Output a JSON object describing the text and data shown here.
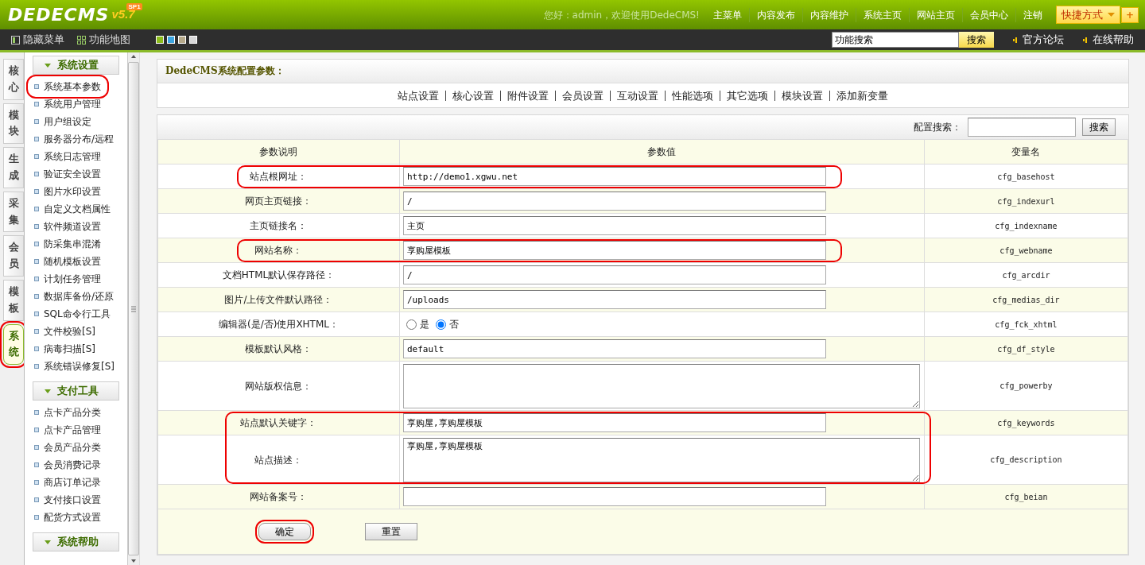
{
  "header": {
    "logo": "DEDECMS",
    "version": "v5.7",
    "edition": "SP1",
    "greeting": "您好：admin，欢迎使用DedeCMS!",
    "nav": [
      "主菜单",
      "内容发布",
      "内容维护",
      "系统主页",
      "网站主页",
      "会员中心",
      "注销"
    ],
    "quick_button": "快捷方式",
    "quick_add": "+"
  },
  "toolbar": {
    "hide_menu": "隐藏菜单",
    "site_map": "功能地图",
    "themes": [
      {
        "color": "#8cbc1c"
      },
      {
        "color": "#3da5e0"
      },
      {
        "color": "#b5a98a"
      },
      {
        "color": "#d8d8d8"
      }
    ],
    "search": {
      "value": "功能搜索",
      "button": "搜索"
    },
    "links": [
      "官方论坛",
      "在线帮助"
    ]
  },
  "side_tabs": [
    {
      "label": "核心",
      "selected": false,
      "highlighted": false
    },
    {
      "label": "模块",
      "selected": false,
      "highlighted": false
    },
    {
      "label": "生成",
      "selected": false,
      "highlighted": false
    },
    {
      "label": "采集",
      "selected": false,
      "highlighted": false
    },
    {
      "label": "会员",
      "selected": false,
      "highlighted": false
    },
    {
      "label": "模板",
      "selected": false,
      "highlighted": false
    },
    {
      "label": "系统",
      "selected": true,
      "highlighted": true
    }
  ],
  "menu_groups": [
    {
      "title": "系统设置",
      "items": [
        {
          "label": "系统基本参数",
          "highlighted": true
        },
        {
          "label": "系统用户管理",
          "highlighted": false
        },
        {
          "label": "用户组设定",
          "highlighted": false
        },
        {
          "label": "服务器分布/远程",
          "highlighted": false
        },
        {
          "label": "系统日志管理",
          "highlighted": false
        },
        {
          "label": "验证安全设置",
          "highlighted": false
        },
        {
          "label": "图片水印设置",
          "highlighted": false
        },
        {
          "label": "自定义文档属性",
          "highlighted": false
        },
        {
          "label": "软件频道设置",
          "highlighted": false
        },
        {
          "label": "防采集串混淆",
          "highlighted": false
        },
        {
          "label": "随机模板设置",
          "highlighted": false
        },
        {
          "label": "计划任务管理",
          "highlighted": false
        },
        {
          "label": "数据库备份/还原",
          "highlighted": false
        },
        {
          "label": "SQL命令行工具",
          "highlighted": false
        },
        {
          "label": "文件校验[S]",
          "highlighted": false
        },
        {
          "label": "病毒扫描[S]",
          "highlighted": false
        },
        {
          "label": "系统错误修复[S]",
          "highlighted": false
        }
      ]
    },
    {
      "title": "支付工具",
      "items": [
        {
          "label": "点卡产品分类",
          "highlighted": false
        },
        {
          "label": "点卡产品管理",
          "highlighted": false
        },
        {
          "label": "会员产品分类",
          "highlighted": false
        },
        {
          "label": "会员消费记录",
          "highlighted": false
        },
        {
          "label": "商店订单记录",
          "highlighted": false
        },
        {
          "label": "支付接口设置",
          "highlighted": false
        },
        {
          "label": "配货方式设置",
          "highlighted": false
        }
      ]
    },
    {
      "title": "系统帮助"
    }
  ],
  "main": {
    "title": "DedeCMS系统配置参数：",
    "sections": [
      "站点设置",
      "核心设置",
      "附件设置",
      "会员设置",
      "互动设置",
      "性能选项",
      "其它选项",
      "模块设置",
      "添加新变量"
    ],
    "config_search": {
      "label": "配置搜索：",
      "button": "搜索"
    },
    "columns": [
      "参数说明",
      "参数值",
      "变量名"
    ],
    "rows": [
      {
        "label": "站点根网址：",
        "kind": "text",
        "value": "http://demo1.xgwu.net",
        "var": "cfg_basehost",
        "highlighted": true
      },
      {
        "label": "网页主页链接：",
        "kind": "text",
        "value": "/",
        "var": "cfg_indexurl",
        "highlighted": false
      },
      {
        "label": "主页链接名：",
        "kind": "text",
        "value": "主页",
        "var": "cfg_indexname",
        "highlighted": false
      },
      {
        "label": "网站名称：",
        "kind": "text",
        "value": "享购屋模板",
        "var": "cfg_webname",
        "highlighted": true
      },
      {
        "label": "文档HTML默认保存路径：",
        "kind": "text",
        "value": "/",
        "var": "cfg_arcdir",
        "highlighted": false
      },
      {
        "label": "图片/上传文件默认路径：",
        "kind": "text",
        "value": "/uploads",
        "var": "cfg_medias_dir",
        "highlighted": false
      },
      {
        "label": "编辑器(是/否)使用XHTML：",
        "kind": "radio",
        "options": [
          {
            "label": "是",
            "selected": false
          },
          {
            "label": "否",
            "selected": true
          }
        ],
        "var": "cfg_fck_xhtml",
        "highlighted": false
      },
      {
        "label": "模板默认风格：",
        "kind": "text",
        "value": "default",
        "var": "cfg_df_style",
        "highlighted": false
      },
      {
        "label": "网站版权信息：",
        "kind": "textarea",
        "var": "cfg_powerby",
        "highlighted": false
      },
      {
        "label": "站点默认关键字：",
        "kind": "text",
        "value": "享购屋,享购屋模板",
        "var": "cfg_keywords",
        "highlighted": true
      },
      {
        "label": "站点描述：",
        "kind": "textarea",
        "value": "享购屋,享购屋模板",
        "var": "cfg_description",
        "highlighted": true
      },
      {
        "label": "网站备案号：",
        "kind": "text",
        "var": "cfg_beian",
        "highlighted": false
      }
    ],
    "buttons": [
      {
        "label": "确定",
        "highlighted": true
      },
      {
        "label": "重置",
        "highlighted": false
      }
    ]
  }
}
